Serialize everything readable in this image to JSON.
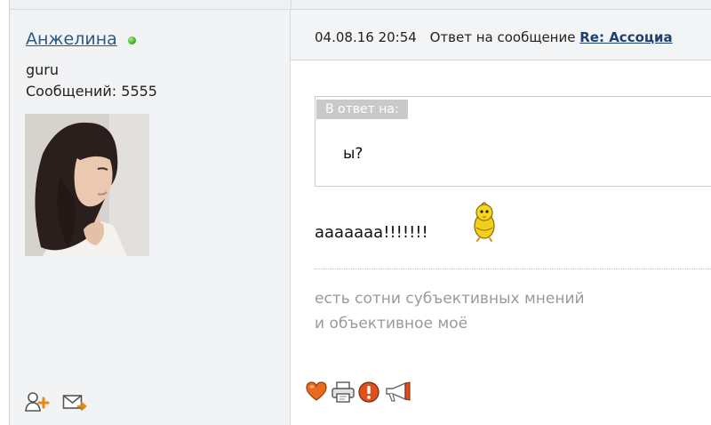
{
  "user": {
    "name": "Анжелина",
    "online": true,
    "rank": "guru",
    "posts_label": "Сообщений: 5555"
  },
  "message": {
    "date": "04.08.16 20:54",
    "reply_prefix": "Ответ на сообщение",
    "reply_title": "Re: Ассоциа",
    "quote_label": "В ответ на:",
    "quote_text": "ы?",
    "body": "ааааааа!!!!!!!",
    "signature": [
      "есть сотни субъективных мнений",
      "и объективное моё"
    ]
  },
  "icons": {
    "user_actions": [
      "add-friend-icon",
      "send-message-icon"
    ],
    "post_actions": [
      "like-heart-icon",
      "print-icon",
      "report-icon",
      "announce-megaphone-icon"
    ],
    "smiley": "dancing-chick-smiley"
  },
  "colors": {
    "username_link": "#2c5a87",
    "online": "#2ea81a",
    "reply_link": "#1d3f72",
    "sidebar_bg": "#f1f3f5",
    "quote_label_bg": "#c9c9c9",
    "signature_text": "#9a9a9a"
  }
}
